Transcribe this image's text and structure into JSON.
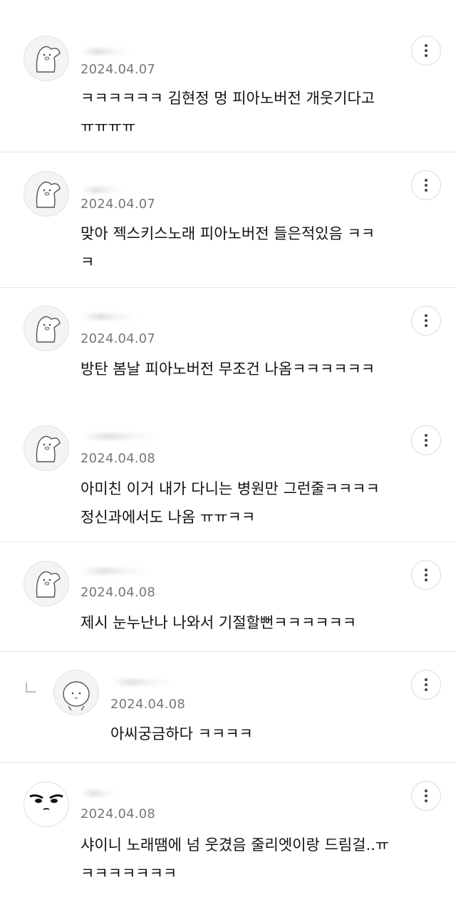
{
  "comments": [
    {
      "date": "2024.04.07",
      "text": "ㅋㅋㅋㅋㅋㅋ 김현정 멍 피아노버전 개웃기다고\nㅠㅠㅠㅠ",
      "avatar": "penguin-avatar"
    },
    {
      "date": "2024.04.07",
      "text": "맞아 젝스키스노래 피아노버전 들은적있음 ㅋㅋ\nㅋ",
      "avatar": "penguin-avatar"
    },
    {
      "date": "2024.04.07",
      "text": "방탄 봄날 피아노버전 무조건 나옴ㅋㅋㅋㅋㅋㅋ",
      "avatar": "penguin-avatar"
    },
    {
      "date": "2024.04.08",
      "text": "아미친 이거 내가 다니는 병원만 그런줄ㅋㅋㅋㅋ\n정신과에서도 나옴 ㅠㅠㅋㅋ",
      "avatar": "penguin-avatar"
    },
    {
      "date": "2024.04.08",
      "text": "제시 눈누난나 나와서 기절할뻔ㅋㅋㅋㅋㅋㅋ",
      "avatar": "penguin-avatar"
    },
    {
      "date": "2024.04.08",
      "text": "아씨궁금하다 ㅋㅋㅋㅋ",
      "avatar": "bun-face-avatar",
      "reply": true
    },
    {
      "date": "2024.04.08",
      "text": "샤이니 노래땜에 넘 웃겼음 줄리엣이랑 드림걸..ㅠ\nㅋㅋㅋㅋㅋㅋㅋ",
      "avatar": "angry-face-avatar"
    }
  ],
  "icons": {
    "more": "more-vertical-icon",
    "reply": "reply-indicator-icon"
  },
  "colors": {
    "divider": "#e6e6e6",
    "date": "#777777",
    "text": "#111111"
  }
}
